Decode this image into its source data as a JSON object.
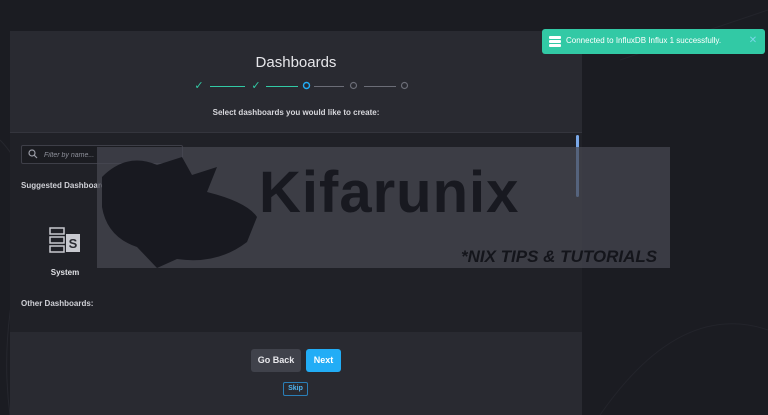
{
  "modal": {
    "title": "Dashboards",
    "subtitle": "Select dashboards you would like to create:",
    "steps": [
      {
        "state": "complete",
        "icon": "check-icon"
      },
      {
        "state": "complete",
        "icon": "check-icon"
      },
      {
        "state": "current",
        "icon": "circle-icon"
      },
      {
        "state": "pending",
        "icon": "circle-icon"
      },
      {
        "state": "pending",
        "icon": "circle-icon"
      }
    ],
    "filter": {
      "placeholder": "Filter by name...",
      "value": ""
    },
    "suggested_heading": "Suggested Dashboards for your Source:",
    "suggested": [
      {
        "label": "System",
        "icon": "system-dashboard-icon"
      }
    ],
    "other_heading": "Other Dashboards:",
    "buttons": {
      "back": "Go Back",
      "next": "Next",
      "skip": "Skip"
    }
  },
  "toast": {
    "message": "Connected to InfluxDB Influx 1 successfully.",
    "icon": "database-icon"
  },
  "watermark": {
    "brand": "Kifarunix",
    "tagline": "*NIX TIPS & TUTORIALS"
  },
  "colors": {
    "accent": "#22adf6",
    "step_complete": "#32c9a5",
    "step_current": "#22adf6",
    "step_pending": "#6b6d77",
    "toast_bg": "#32c9a5",
    "modal_bg": "#292a31",
    "page_bg": "#1b1c22"
  }
}
